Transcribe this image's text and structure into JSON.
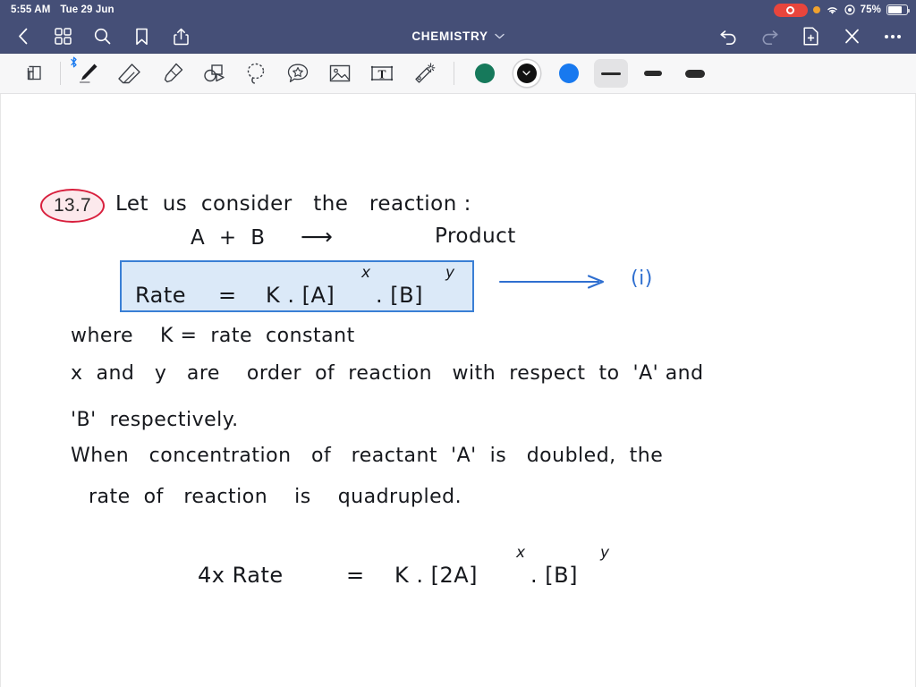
{
  "status_bar": {
    "time": "5:55 AM",
    "date": "Tue 29 Jun",
    "battery_percent": "75%",
    "icons": [
      "screen-recording-indicator",
      "orange-privacy-dot",
      "wifi-icon",
      "location-icon",
      "battery-icon"
    ],
    "background_color": "#454f77"
  },
  "nav_bar": {
    "title": "CHEMISTRY",
    "left_icons": [
      "back-chevron-icon",
      "grid-icon",
      "search-icon",
      "bookmark-icon",
      "share-icon"
    ],
    "right_icons": [
      "undo-icon",
      "redo-icon",
      "add-page-icon",
      "close-icon",
      "more-options-icon"
    ],
    "title_chevron": "chevron-down-icon"
  },
  "toolbar": {
    "tools": [
      {
        "name": "page-layers-tool",
        "active": false
      },
      {
        "name": "pen-tool",
        "active": true,
        "badge": "bluetooth-icon"
      },
      {
        "name": "eraser-tool",
        "active": false
      },
      {
        "name": "highlighter-tool",
        "active": false
      },
      {
        "name": "shapes-tool",
        "active": false
      },
      {
        "name": "lasso-tool",
        "active": false
      },
      {
        "name": "sticker-tool",
        "active": false
      },
      {
        "name": "image-tool",
        "active": false
      },
      {
        "name": "text-box-tool",
        "active": false
      },
      {
        "name": "magic-wand-tool",
        "active": false
      }
    ],
    "colors": [
      {
        "name": "green-swatch",
        "hex": "#16795b",
        "selected": false
      },
      {
        "name": "black-swatch",
        "hex": "#111111",
        "selected": true
      },
      {
        "name": "blue-swatch",
        "hex": "#1879ef",
        "selected": false
      }
    ],
    "stroke_widths": [
      {
        "name": "thin-stroke",
        "selected": true
      },
      {
        "name": "medium-stroke",
        "selected": false
      },
      {
        "name": "thick-stroke",
        "selected": false
      }
    ]
  },
  "note": {
    "question_number": "13.7",
    "question_number_circle_color": "#d81f3d",
    "line1": "Let  us  consider   the   reaction :",
    "reaction_left": "A  +  B",
    "reaction_arrow": "⟶",
    "reaction_right": "Product",
    "rate_equation": {
      "lhs": "Rate",
      "equals": "=",
      "rhs_k": "K . [A]",
      "exp_x": "x",
      "rhs_b": ". [B]",
      "exp_y": "y",
      "box_fill": "#dbe9f8",
      "box_border": "#3a7fd5"
    },
    "equation_label": "(i)",
    "equation_arrow": "⟶",
    "line_where": "where    K =  rate  constant",
    "line_xy": "x  and   y   are    order  of  reaction   with  respect  to  'A' and",
    "line_b": "'B'  respectively.",
    "line_when": "When   concentration   of   reactant  'A'  is   doubled,  the",
    "line_rate": "rate  of   reaction    is    quadrupled.",
    "final_equation": {
      "lhs": "4x Rate",
      "equals": "=",
      "rhs_k": "K . [2A]",
      "exp_x": "x",
      "rhs_b": ". [B]",
      "exp_y": "y"
    }
  }
}
